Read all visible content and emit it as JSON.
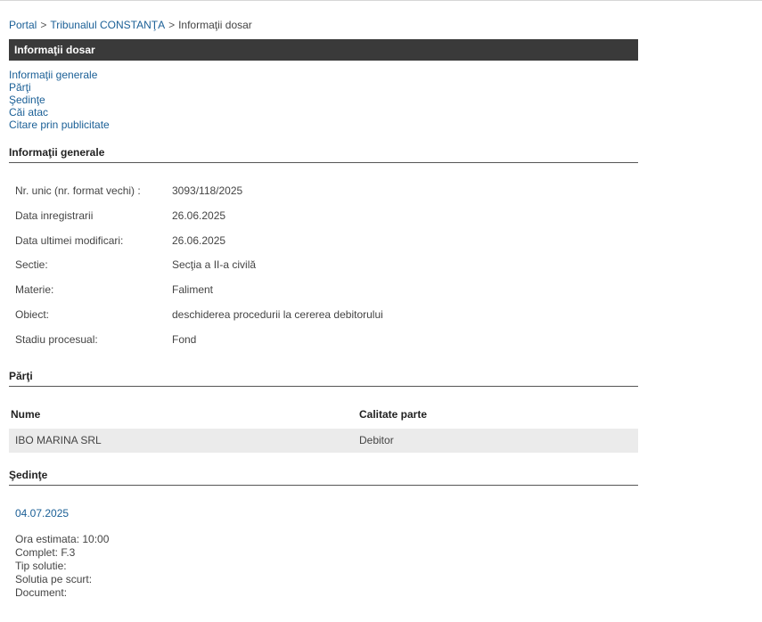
{
  "breadcrumb": {
    "portal": "Portal",
    "court": "Tribunalul CONSTANŢA",
    "current": "Informaţii dosar",
    "separator": ">"
  },
  "title_bar": "Informaţii dosar",
  "anchors": [
    "Informaţii generale",
    "Părţi",
    "Şedinţe",
    "Căi atac",
    "Citare prin publicitate"
  ],
  "sections": {
    "general": "Informaţii generale",
    "parti": "Părţi",
    "sedinte": "Şedinţe"
  },
  "general_info": [
    {
      "label": "Nr. unic (nr. format vechi) :",
      "value": "3093/118/2025"
    },
    {
      "label": "Data inregistrarii",
      "value": "26.06.2025"
    },
    {
      "label": "Data ultimei modificari:",
      "value": "26.06.2025"
    },
    {
      "label": "Sectie:",
      "value": "Secţia a II-a civilă"
    },
    {
      "label": "Materie:",
      "value": "Faliment"
    },
    {
      "label": "Obiect:",
      "value": "deschiderea procedurii la cererea debitorului"
    },
    {
      "label": "Stadiu procesual:",
      "value": "Fond"
    }
  ],
  "parti": {
    "headers": [
      "Nume",
      "Calitate parte"
    ],
    "rows": [
      [
        "IBO MARINA SRL",
        "Debitor"
      ]
    ]
  },
  "sedinta": {
    "date": "04.07.2025",
    "details": [
      "Ora estimata: 10:00",
      "Complet: F.3",
      "Tip solutie:",
      "Solutia pe scurt:",
      "Document:"
    ]
  },
  "colors": {
    "link": "#1a5f96",
    "title_bar_bg": "#3a3a3a",
    "row_bg": "#ebebeb"
  }
}
